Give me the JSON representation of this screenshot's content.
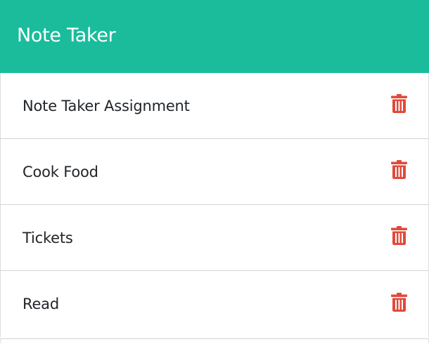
{
  "header": {
    "title": "Note Taker"
  },
  "notes": [
    {
      "label": "Note Taker Assignment",
      "action_icon": "trash-icon"
    },
    {
      "label": "Cook Food",
      "action_icon": "trash-icon"
    },
    {
      "label": "Tickets",
      "action_icon": "trash-icon"
    },
    {
      "label": "Read",
      "action_icon": "trash-icon"
    }
  ],
  "colors": {
    "header_bg": "#1abc9c",
    "header_text": "#ffffff",
    "delete_icon": "#e04a3c",
    "item_text": "#212529",
    "divider": "#d4d4d4"
  }
}
